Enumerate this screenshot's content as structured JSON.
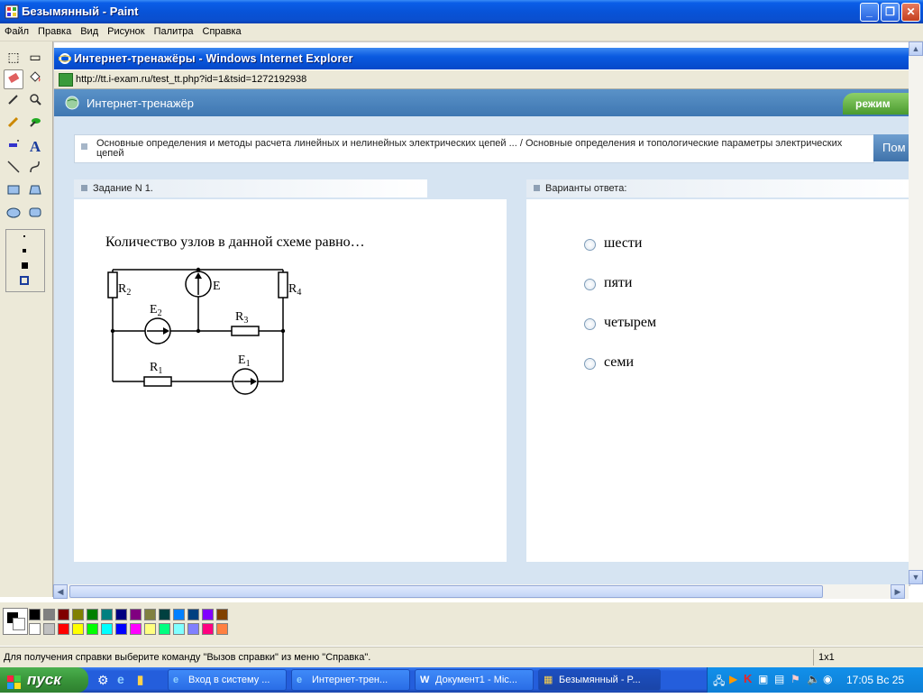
{
  "window": {
    "title": "Безымянный - Paint"
  },
  "menu": [
    "Файл",
    "Правка",
    "Вид",
    "Рисунок",
    "Палитра",
    "Справка"
  ],
  "ie": {
    "title": "Интернет-тренажёры - Windows Internet Explorer",
    "url": "http://tt.i-exam.ru/test_tt.php?id=1&tsid=1272192938"
  },
  "page": {
    "header_title": "Интернет-тренажёр",
    "mode_label": "режим",
    "breadcrumb": "Основные определения и методы расчета линейных и нелинейных электрических цепей ... / Основные определения и топологические параметры электрических цепей",
    "breadcrumb_button": "Пом",
    "task_title": "Задание N 1.",
    "answers_title": "Варианты ответа:",
    "question": "Количество узлов в данной схеме равно…",
    "options": [
      "шести",
      "пяти",
      "четырем",
      "семи"
    ],
    "circuit_labels": {
      "r2": "R",
      "r2_sub": "2",
      "e": "E",
      "r4": "R",
      "r4_sub": "4",
      "e2": "E",
      "e2_sub": "2",
      "r3": "R",
      "r3_sub": "3",
      "r1": "R",
      "r1_sub": "1",
      "e1": "E",
      "e1_sub": "1"
    }
  },
  "status": {
    "help": "Для получения справки выберите команду \"Вызов справки\" из меню \"Справка\".",
    "coords": "1x1"
  },
  "taskbar": {
    "start": "пуск",
    "tasks": [
      "Вход в систему ...",
      "Интернет-трен...",
      "Документ1 - Mic...",
      "Безымянный - P..."
    ],
    "clock": "17:05 Вс 25"
  },
  "palette": {
    "row1": [
      "#000000",
      "#808080",
      "#800000",
      "#808000",
      "#008000",
      "#008080",
      "#000080",
      "#800080",
      "#808040",
      "#004040",
      "#0080ff",
      "#004080",
      "#8000ff",
      "#804000"
    ],
    "row2": [
      "#ffffff",
      "#c0c0c0",
      "#ff0000",
      "#ffff00",
      "#00ff00",
      "#00ffff",
      "#0000ff",
      "#ff00ff",
      "#ffff80",
      "#00ff80",
      "#80ffff",
      "#8080ff",
      "#ff0080",
      "#ff8040"
    ]
  }
}
